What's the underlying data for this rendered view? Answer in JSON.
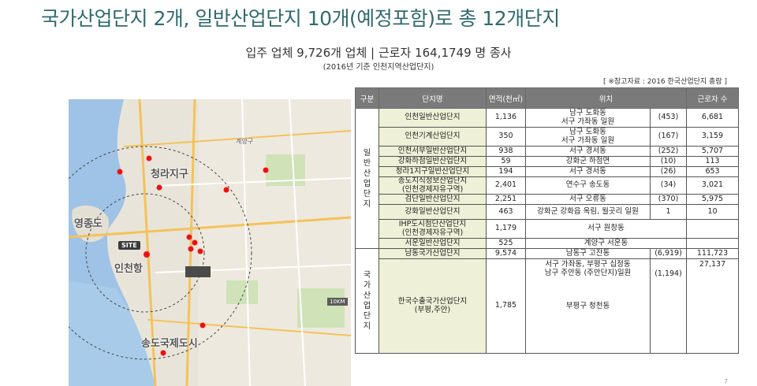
{
  "header": {
    "title": "국가산업단지 2개, 일반산업단지 10개(예정포함)로 총 12개단지",
    "subtitle": "입주 업체 9,726개 업체  |  근로자 164,1749 명 종사",
    "subnote": "(2016년 기준 인천지역산업단지)",
    "reference": "[ ※참고자료 : 2016 한국산업단지 총람 ]"
  },
  "map": {
    "labels": {
      "cheongna": "청라지구",
      "yeongjong": "영종도",
      "incheon_port": "인천항",
      "songdo": "송도국제도시",
      "gyeyang": "계양구"
    },
    "site_label": "SITE",
    "scale_label": "10KM",
    "colors": {
      "sea": "#9ec3e6",
      "land": "#ebe6dc",
      "marker": "#e11",
      "road": "#f4c25a"
    }
  },
  "table": {
    "headers": [
      "구분",
      "단지명",
      "면적(천㎡)",
      "위치",
      "근로자 수"
    ],
    "groups": [
      {
        "category": "일반산업단지",
        "rows": [
          {
            "name": "인천일반산업단지",
            "area": "1,136",
            "location": "남구 도화동\n서구 가좌동 일원",
            "firms": "(453)",
            "workers": "6,681"
          },
          {
            "name": "인천기계산업단지",
            "area": "350",
            "location": "남구 도화동\n서구 가좌동 일원",
            "firms": "(167)",
            "workers": "3,159"
          },
          {
            "name": "인천서부일반산업단지",
            "area": "938",
            "location": "서구 경서동",
            "firms": "(252)",
            "workers": "5,707"
          },
          {
            "name": "강화하점일반산업단지",
            "area": "59",
            "location": "강화군 하점면",
            "firms": "(10)",
            "workers": "113"
          },
          {
            "name": "청라1지구일반산업단지",
            "area": "194",
            "location": "서구 경서동",
            "firms": "(26)",
            "workers": "653"
          },
          {
            "name": "송도지식정보산업단지\n(인천경제자유구역)",
            "area": "2,401",
            "location": "연수구 송도동",
            "firms": "(34)",
            "workers": "3,021"
          },
          {
            "name": "검단일반산업단지",
            "area": "2,251",
            "location": "서구 오류동",
            "firms": "(370)",
            "workers": "5,975"
          },
          {
            "name": "강화일반산업단지",
            "area": "463",
            "location": "강화군 강화읍 옥림, 월곳리 일원",
            "firms": "1",
            "workers": "10"
          },
          {
            "name": "IHP도시첨단산업단지\n(인천경제자유구역)",
            "area": "1,179",
            "location": "서구 원창동",
            "firms": "",
            "workers": ""
          },
          {
            "name": "서운일반산업단지",
            "area": "525",
            "location": "계양구 서운동",
            "firms": "",
            "workers": ""
          }
        ]
      },
      {
        "category": "국가산업단지",
        "rows": [
          {
            "name": "남동국가산업단지",
            "area": "9,574",
            "location": "남동구 고잔동",
            "firms": "(6,919)",
            "workers": "111,723"
          },
          {
            "name": "한국수출국가산업단지\n(부평,주안)",
            "area": "1,785",
            "location": "서구 가좌동, 부평구 십정동\n남구 주안동 (주안단지)일원\n\n\n\n부평구 청천동",
            "firms": "(1,194)",
            "workers": "27,137"
          }
        ]
      }
    ]
  },
  "footer": {
    "page": "7"
  }
}
